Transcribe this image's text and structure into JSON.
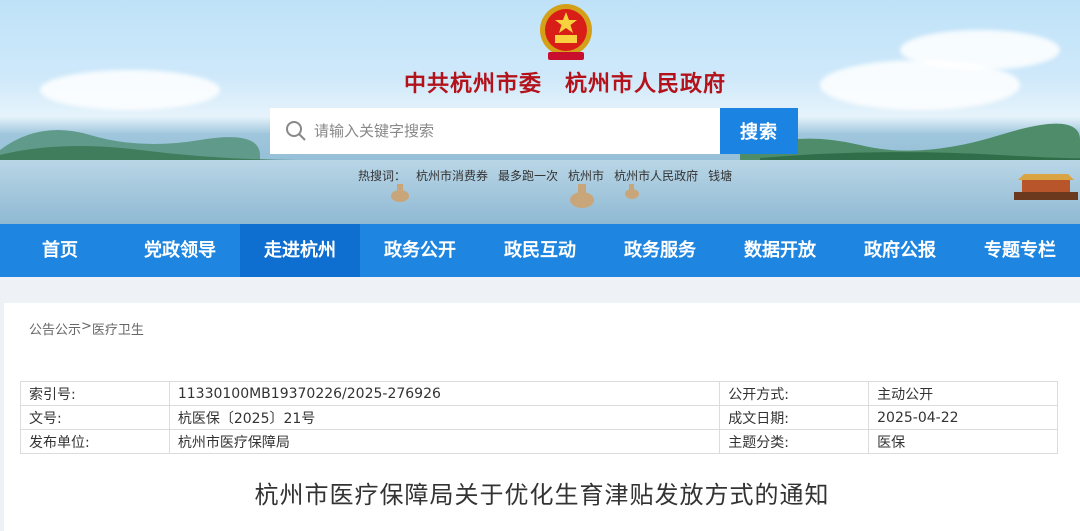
{
  "header": {
    "site_title": "中共杭州市委　杭州市人民政府",
    "search": {
      "placeholder": "请输入关键字搜索",
      "button_label": "搜索"
    },
    "hot_keywords": [
      "热搜词：",
      "杭州市消费券",
      "最多跑一次",
      "杭州市",
      "杭州市人民政府",
      "钱塘"
    ]
  },
  "nav": {
    "items": [
      "首页",
      "党政领导",
      "走进杭州",
      "政务公开",
      "政民互动",
      "政务服务",
      "数据开放",
      "政府公报",
      "专题专栏"
    ],
    "active_index": 2
  },
  "breadcrumb": [
    "公告公示",
    ">",
    "医疗卫生"
  ],
  "meta": {
    "rows": [
      [
        "索引号:",
        "11330100MB19370226/2025-276926",
        "公开方式:",
        "主动公开"
      ],
      [
        "文号:",
        "杭医保〔2025〕21号",
        "成文日期:",
        "2025-04-22"
      ],
      [
        "发布单位:",
        "杭州市医疗保障局",
        "主题分类:",
        "医保"
      ]
    ]
  },
  "document": {
    "title": "杭州市医疗保障局关于优化生育津贴发放方式的通知"
  },
  "colors": {
    "nav_blue": "#1e86e0",
    "nav_active": "#0f6fd0",
    "search_button": "#1b84e3",
    "title_red": "#b3121b"
  }
}
